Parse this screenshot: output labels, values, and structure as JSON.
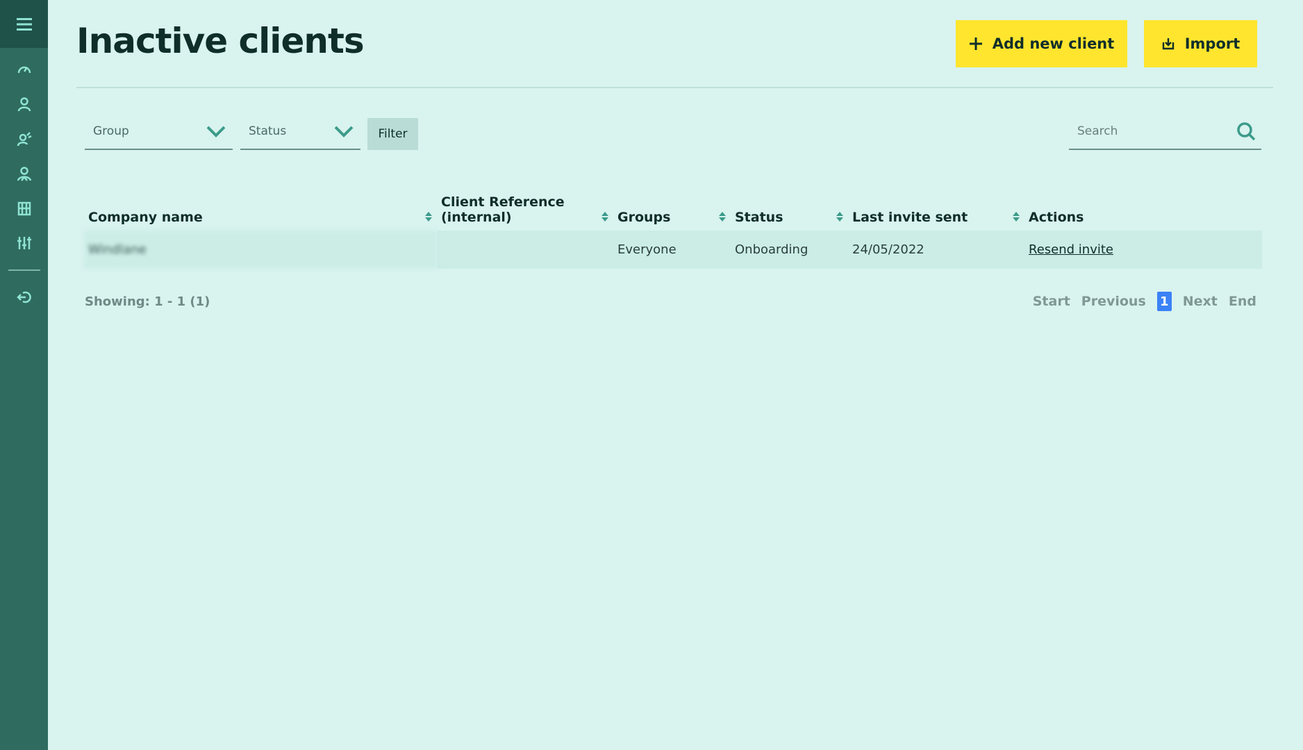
{
  "page": {
    "title": "Inactive clients"
  },
  "actions": {
    "add_label": "Add new client",
    "import_label": "Import"
  },
  "filters": {
    "group_label": "Group",
    "status_label": "Status",
    "filter_button": "Filter",
    "search_placeholder": "Search"
  },
  "sidebar": {
    "icons": [
      "menu-icon",
      "dashboard-icon",
      "user-icon",
      "user-activity-icon",
      "users-group-icon",
      "building-icon",
      "sliders-icon",
      "logout-icon"
    ]
  },
  "table": {
    "columns": [
      "Company name",
      "Client Reference (internal)",
      "Groups",
      "Status",
      "Last invite sent",
      "Actions"
    ],
    "rows": [
      {
        "company": "Windlane",
        "reference": "",
        "groups": "Everyone",
        "status": "Onboarding",
        "last_invite": "24/05/2022",
        "action": "Resend invite"
      }
    ]
  },
  "pagination": {
    "showing": "Showing: 1 - 1 (1)",
    "start": "Start",
    "previous": "Previous",
    "current": "1",
    "next": "Next",
    "end": "End"
  },
  "colors": {
    "background": "#d9f3ef",
    "sidebar": "#2f6b5f",
    "accent_yellow": "#ffe52e",
    "icon_teal": "#8fe3d3",
    "current_page": "#3b82f6"
  }
}
